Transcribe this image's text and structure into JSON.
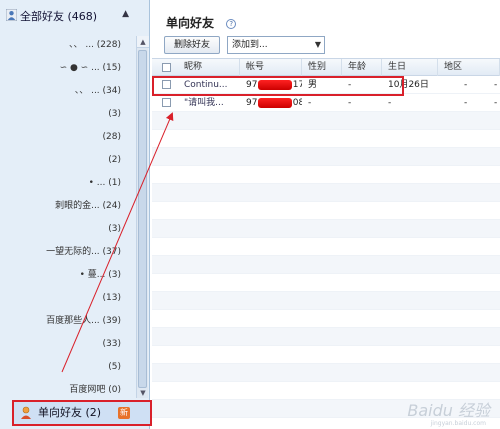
{
  "left": {
    "header_label": "全部好友 (468)",
    "groups": [
      "、、 ... (228)",
      "∽ ● ∽ ... (15)",
      "、、 ... (34)",
      "(3)",
      "(28)",
      "(2)",
      "• ... (1)",
      "刺眼的金... (24)",
      "(3)",
      "一望无际的... (37)",
      "• 蔓... (3)",
      "(13)",
      "百度那些人... (39)",
      "(33)",
      "(5)",
      "百度网吧 (0)"
    ],
    "oneway_label": "单向好友 (2)",
    "new_badge": "新"
  },
  "right": {
    "title": "单向好友",
    "help": "?",
    "delete_button": "删除好友",
    "addto_select": "添加到...",
    "columns": [
      "昵称",
      "帐号",
      "性别",
      "年龄",
      "生日",
      "地区"
    ],
    "rows": [
      {
        "nickname": "Continu...",
        "account_prefix": "97",
        "account_suffix": "17",
        "gender": "男",
        "age": "-",
        "birthday": "10月26日",
        "region": "-",
        "extra": "-"
      },
      {
        "nickname": "\"请叫我...",
        "account_prefix": "97",
        "account_suffix": "08",
        "gender": "-",
        "age": "-",
        "birthday": "-",
        "region": "-",
        "extra": "-"
      }
    ]
  },
  "watermark": "Baidu 经验",
  "watermark_sub": "jingyan.baidu.com",
  "colors": {
    "highlight": "#d9202a",
    "panel_bg": "#e4eef8",
    "badge": "#e8722a"
  }
}
